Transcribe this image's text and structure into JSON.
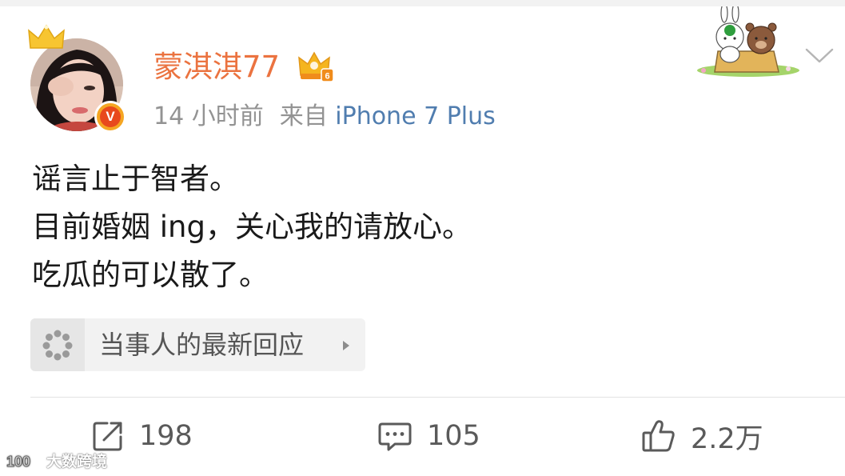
{
  "post": {
    "author": {
      "name": "蒙淇淇77",
      "verified_badge": "V",
      "avatar_icon": "avatar-photo",
      "crown_icon": "crown-icon",
      "vip_icon": "vip-crown-level-6",
      "vip_level": "6"
    },
    "time": "14 小时前",
    "source_prefix": "来自",
    "source": "iPhone 7 Plus",
    "content": {
      "line1": "谣言止于智者。",
      "line2": "目前婚姻 ing，关心我的请放心。",
      "line3": "吃瓜的可以散了。"
    },
    "link_card": {
      "label": "当事人的最新回应",
      "icon": "loading-dots-icon"
    },
    "actions": {
      "repost_count": "198",
      "comment_count": "105",
      "like_count": "2.2万"
    }
  },
  "watermark": {
    "text": "大数跨境",
    "logo_text": "100"
  },
  "colors": {
    "username": "#eb7340",
    "source_link": "#507daf",
    "meta_gray": "#939393",
    "body_text": "#1a1a1a",
    "card_bg": "#f2f2f2",
    "divider": "#e3e3e3"
  }
}
